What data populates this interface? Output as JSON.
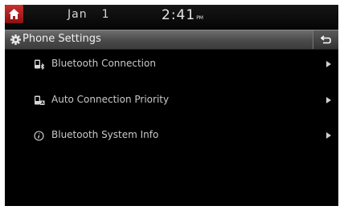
{
  "status_bar": {
    "date_month": "Jan",
    "date_day": "1",
    "time": "2:41",
    "time_suffix": "PM"
  },
  "header": {
    "title": "Phone Settings"
  },
  "menu": {
    "items": [
      {
        "label": "Bluetooth Connection",
        "icon": "bluetooth-phone-icon"
      },
      {
        "label": "Auto Connection Priority",
        "icon": "auto-connect-phone-icon"
      },
      {
        "label": "Bluetooth System Info",
        "icon": "info-icon"
      }
    ]
  },
  "colors": {
    "accent_red": "#b81d1f",
    "background": "#000000",
    "title_bar": "#555555",
    "text": "#c9c9c9"
  }
}
